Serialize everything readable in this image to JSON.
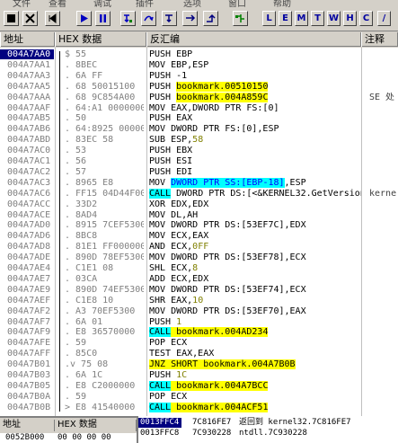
{
  "menu": [
    "文件",
    "查看",
    "调试",
    "插件",
    "选项",
    "窗口",
    "帮助"
  ],
  "toolbar_icons": [
    "stop-icon",
    "close-icon",
    "run-icon",
    "pause-icon",
    "step-into-icon",
    "step-over-icon",
    "trace-into-icon",
    "trace-over-icon",
    "execute-till-return-icon",
    "goto-icon"
  ],
  "toolbar_letters": [
    "L",
    "E",
    "M",
    "T",
    "W",
    "H",
    "C",
    "/"
  ],
  "headers": {
    "addr": "地址",
    "hex": "HEX 数据",
    "dis": "反汇编",
    "cmt": "注释"
  },
  "rows": [
    {
      "addr": "004A7AA0",
      "hex": "$  55",
      "dis": "PUSH EBP",
      "cmt": ""
    },
    {
      "addr": "004A7AA1",
      "hex": ".  8BEC",
      "dis": "MOV EBP,ESP",
      "cmt": ""
    },
    {
      "addr": "004A7AA3",
      "hex": ".  6A FF",
      "dis": "PUSH -1",
      "cmt": ""
    },
    {
      "addr": "004A7AA5",
      "hex": ".  68 50015100",
      "dis_pre": "PUSH ",
      "dis_hl": "bookmark.00510150",
      "cmt": ""
    },
    {
      "addr": "004A7AAA",
      "hex": ".  68 9C854A00",
      "dis_pre": "PUSH ",
      "dis_hl": "bookmark.004A859C",
      "cmt": "SE 处"
    },
    {
      "addr": "004A7AAF",
      "hex": ".  64:A1 0000000",
      "dis": "MOV EAX,DWORD PTR FS:[0]",
      "cmt": ""
    },
    {
      "addr": "004A7AB5",
      "hex": ".  50",
      "dis": "PUSH EAX",
      "cmt": ""
    },
    {
      "addr": "004A7AB6",
      "hex": ".  64:8925 000000",
      "dis": "MOV DWORD PTR FS:[0],ESP",
      "cmt": ""
    },
    {
      "addr": "004A7ABD",
      "hex": ".  83EC 58",
      "dis": "SUB ESP,",
      "dis_num": "58",
      "cmt": ""
    },
    {
      "addr": "004A7AC0",
      "hex": ".  53",
      "dis": "PUSH EBX",
      "cmt": ""
    },
    {
      "addr": "004A7AC1",
      "hex": ".  56",
      "dis": "PUSH ESI",
      "cmt": ""
    },
    {
      "addr": "004A7AC2",
      "hex": ".  57",
      "dis": "PUSH EDI",
      "cmt": ""
    },
    {
      "addr": "004A7AC3",
      "hex": ".  8965 E8",
      "dis_pre": "MOV ",
      "dis_cyan": "DWORD PTR SS:[EBP-18]",
      "dis_post": ",ESP",
      "cmt": ""
    },
    {
      "addr": "004A7AC6",
      "hex": ".  FF15 04D44F00",
      "dis_call": "CALL",
      "dis_post": " DWORD PTR DS:[<&KERNEL32.GetVersion",
      "cmt": "kerne"
    },
    {
      "addr": "004A7ACC",
      "hex": ".  33D2",
      "dis": "XOR EDX,EDX",
      "cmt": ""
    },
    {
      "addr": "004A7ACE",
      "hex": ".  8AD4",
      "dis": "MOV DL,AH",
      "cmt": ""
    },
    {
      "addr": "004A7AD0",
      "hex": ".  8915 7CEF5300",
      "dis": "MOV DWORD PTR DS:[53EF7C],EDX",
      "cmt": ""
    },
    {
      "addr": "004A7AD6",
      "hex": ".  8BC8",
      "dis": "MOV ECX,EAX",
      "cmt": ""
    },
    {
      "addr": "004A7AD8",
      "hex": ".  81E1 FF000000",
      "dis": "AND ECX,",
      "dis_num": "0FF",
      "cmt": ""
    },
    {
      "addr": "004A7ADE",
      "hex": ".  890D 78EF5300",
      "dis": "MOV DWORD PTR DS:[53EF78],ECX",
      "cmt": ""
    },
    {
      "addr": "004A7AE4",
      "hex": ".  C1E1 08",
      "dis": "SHL ECX,",
      "dis_num": "8",
      "cmt": ""
    },
    {
      "addr": "004A7AE7",
      "hex": ".  03CA",
      "dis": "ADD ECX,EDX",
      "cmt": ""
    },
    {
      "addr": "004A7AE9",
      "hex": ".  890D 74EF5300",
      "dis": "MOV DWORD PTR DS:[53EF74],ECX",
      "cmt": ""
    },
    {
      "addr": "004A7AEF",
      "hex": ".  C1E8 10",
      "dis": "SHR EAX,",
      "dis_num": "10",
      "cmt": ""
    },
    {
      "addr": "004A7AF2",
      "hex": ".  A3 70EF5300",
      "dis": "MOV DWORD PTR DS:[53EF70],EAX",
      "cmt": ""
    },
    {
      "addr": "004A7AF7",
      "hex": ".  6A 01",
      "dis": "PUSH ",
      "dis_num": "1",
      "cmt": ""
    },
    {
      "addr": "004A7AF9",
      "hex": ".  E8 36570000",
      "dis_call": "CALL",
      "dis_hl2": " bookmark.004AD234",
      "cmt": ""
    },
    {
      "addr": "004A7AFE",
      "hex": ".  59",
      "dis": "POP ECX",
      "cmt": ""
    },
    {
      "addr": "004A7AFF",
      "hex": ".  85C0",
      "dis": "TEST EAX,EAX",
      "cmt": ""
    },
    {
      "addr": "004A7B01",
      "hex": ".v 75 08",
      "dis_jnz": "JNZ",
      "dis_hl2": " SHORT bookmark.004A7B0B",
      "cmt": ""
    },
    {
      "addr": "004A7B03",
      "hex": ".  6A 1C",
      "dis": "PUSH ",
      "dis_num": "1C",
      "cmt": ""
    },
    {
      "addr": "004A7B05",
      "hex": ".  E8 C2000000",
      "dis_call": "CALL",
      "dis_hl2": " bookmark.004A7BCC",
      "cmt": ""
    },
    {
      "addr": "004A7B0A",
      "hex": ".  59",
      "dis": "POP ECX",
      "cmt": ""
    },
    {
      "addr": "004A7B0B",
      "hex": ">  E8 41540000",
      "dis_call": "CALL",
      "dis_hl2": " bookmark.004ACF51",
      "cmt": ""
    }
  ],
  "dump": {
    "addr_hdr": "地址",
    "hex_hdr": "HEX 数据",
    "addr": "0052B000",
    "hex": "00 00 00 00"
  },
  "stack": [
    {
      "addr": "0013FFC4",
      "val": "7C816FE7",
      "cmt": "返回到 kernel32.7C816FE7"
    },
    {
      "addr": "0013FFC8",
      "val": "7C930228",
      "cmt": "ntdll.7C930228"
    }
  ],
  "colors": {
    "selection": "#000080",
    "call_bg": "#00ffff",
    "bookmark_bg": "#ffff00",
    "jump_bg": "#ffff00"
  }
}
